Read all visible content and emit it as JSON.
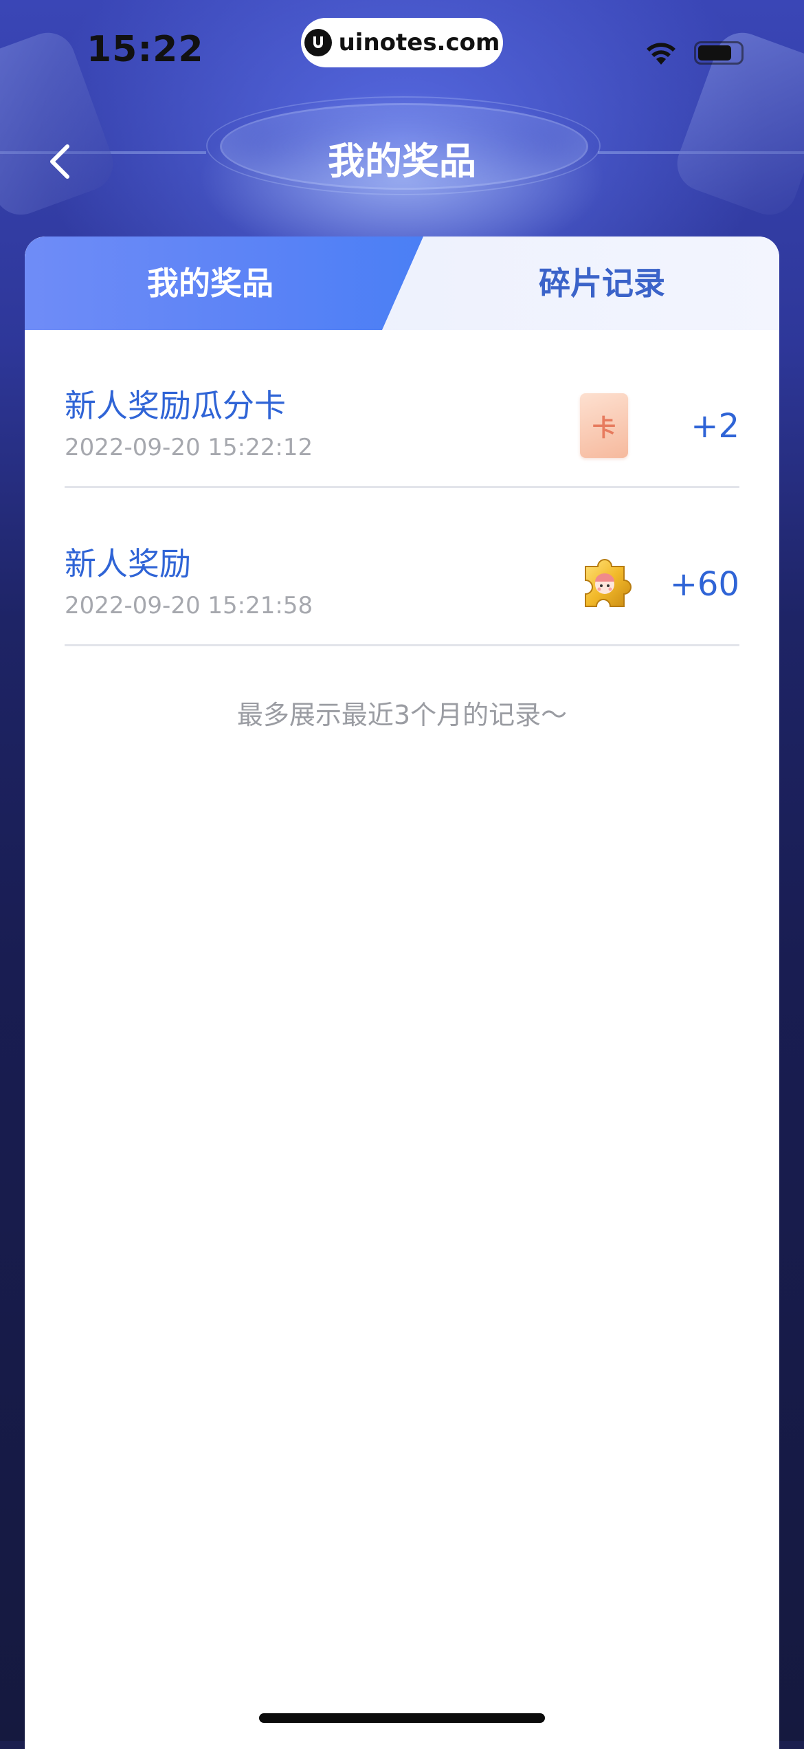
{
  "status_bar": {
    "time": "15:22",
    "watermark": "uinotes.com",
    "icons": [
      "wifi-icon",
      "battery-icon"
    ]
  },
  "nav": {
    "back_icon": "chevron-left-icon",
    "title": "我的奖品"
  },
  "tabs": [
    {
      "label": "我的奖品",
      "active": true
    },
    {
      "label": "碎片记录",
      "active": false
    }
  ],
  "colors": {
    "accent": "#2f64d6",
    "tab_active": "#5b83f6",
    "tab_inactive_text": "#3b63c9",
    "secondary_text": "#a6a8ae"
  },
  "records": [
    {
      "title": "新人奖励瓜分卡",
      "time": "2022-09-20 15:22:12",
      "icon": "card-icon",
      "icon_char": "卡",
      "amount": "+2"
    },
    {
      "title": "新人奖励",
      "time": "2022-09-20 15:21:58",
      "icon": "puzzle-icon",
      "amount": "+60"
    }
  ],
  "footer_note": "最多展示最近3个月的记录～"
}
